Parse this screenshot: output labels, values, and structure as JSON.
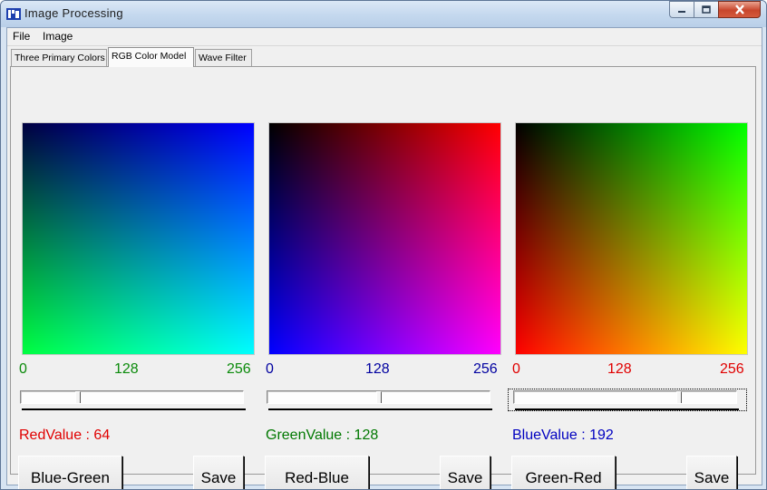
{
  "window": {
    "title": "Image Processing"
  },
  "menu": [
    "File",
    "Image"
  ],
  "tabs": [
    "Three Primary Colors",
    "RGB Color Model",
    "Wave Filter"
  ],
  "active_tab": "RGB Color Model",
  "panels": [
    {
      "scale": [
        "0",
        "128",
        "256"
      ],
      "scale_color": "#0a8a0a",
      "slider_value": 64,
      "slider_max": 256,
      "value_label": "RedValue : 64",
      "value_color": "#e00000",
      "button": "Blue-Green",
      "save": "Save"
    },
    {
      "scale": [
        "0",
        "128",
        "256"
      ],
      "scale_color": "#0000a0",
      "slider_value": 128,
      "slider_max": 256,
      "value_label": "GreenValue : 128",
      "value_color": "#007800",
      "button": "Red-Blue",
      "save": "Save"
    },
    {
      "scale": [
        "0",
        "128",
        "256"
      ],
      "scale_color": "#e00000",
      "slider_value": 192,
      "slider_max": 256,
      "value_label": "BlueValue : 192",
      "value_color": "#0000c0",
      "button": "Green-Red",
      "save": "Save"
    }
  ],
  "icons": {
    "app": "app-icon",
    "minimize": "minimize-icon",
    "maximize": "maximize-icon",
    "close": "close-icon"
  }
}
